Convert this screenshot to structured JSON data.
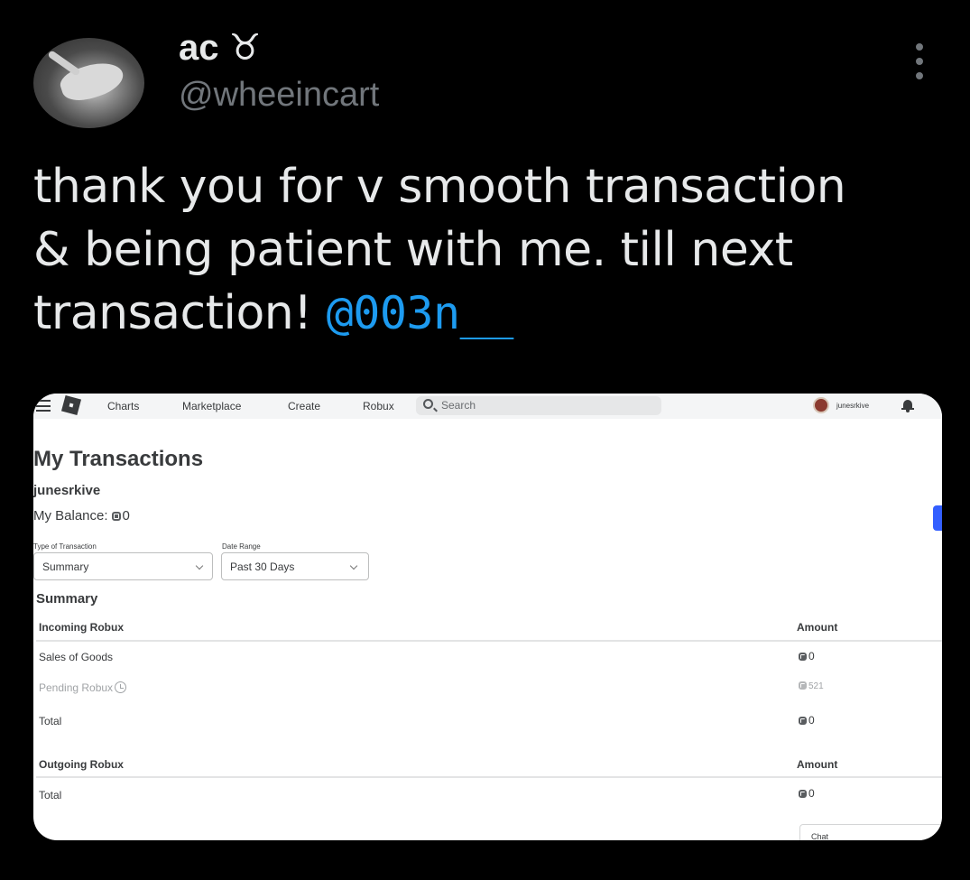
{
  "tweet": {
    "display_name": "ac ♉︎",
    "handle": "@wheeincart",
    "text_line1": "thank you for v smooth transaction",
    "text_line2": "& being patient with me. till next",
    "text_line3": "transaction! ",
    "mention": "@003n__"
  },
  "screenshot": {
    "nav": [
      "Charts",
      "Marketplace",
      "Create",
      "Robux"
    ],
    "search_placeholder": "Search",
    "username_top": "junesrkive",
    "page_title": "My Transactions",
    "username": "junesrkive",
    "balance_label": "My Balance:",
    "balance_value": "0",
    "filters": {
      "type_label": "Type of Transaction",
      "type_value": "Summary",
      "date_label": "Date Range",
      "date_value": "Past 30 Days"
    },
    "summary_title": "Summary",
    "incoming": {
      "header": "Incoming Robux",
      "amount_header": "Amount",
      "rows": [
        {
          "label": "Sales of Goods",
          "value": "0"
        },
        {
          "label": "Pending Robux",
          "value": "521"
        },
        {
          "label": "Total",
          "value": "0"
        }
      ]
    },
    "outgoing": {
      "header": "Outgoing Robux",
      "amount_header": "Amount",
      "rows": [
        {
          "label": "Total",
          "value": "0"
        }
      ]
    },
    "chat_label": "Chat"
  }
}
